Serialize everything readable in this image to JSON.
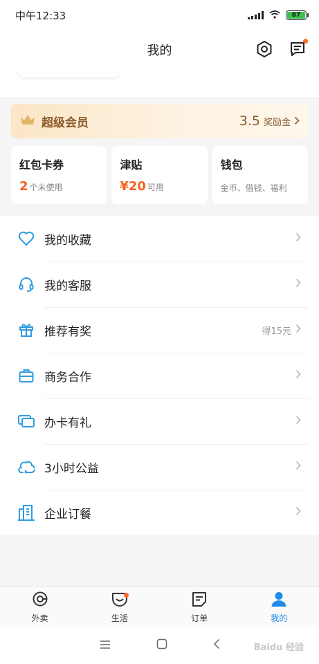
{
  "status_bar": {
    "time": "中午12:33",
    "battery": "87"
  },
  "header": {
    "title": "我的"
  },
  "vip": {
    "label": "超级会员",
    "amount": "3.5",
    "unit": "奖励金"
  },
  "cards": [
    {
      "title": "红包卡券",
      "number": "2",
      "suffix": "个未使用"
    },
    {
      "title": "津贴",
      "number": "¥20",
      "suffix": "可用"
    },
    {
      "title": "钱包",
      "number": "",
      "suffix": "金币、借钱、福利"
    }
  ],
  "menu": [
    {
      "label": "我的收藏",
      "icon": "heart-icon",
      "extra": ""
    },
    {
      "label": "我的客服",
      "icon": "headset-icon",
      "extra": ""
    },
    {
      "label": "推荐有奖",
      "icon": "gift-icon",
      "extra": "得15元"
    },
    {
      "label": "商务合作",
      "icon": "briefcase-icon",
      "extra": ""
    },
    {
      "label": "办卡有礼",
      "icon": "cards-icon",
      "extra": ""
    },
    {
      "label": "3小时公益",
      "icon": "charity-cloud-icon",
      "extra": ""
    },
    {
      "label": "企业订餐",
      "icon": "building-icon",
      "extra": ""
    }
  ],
  "tabs": [
    {
      "label": "外卖",
      "icon": "takeout-icon"
    },
    {
      "label": "生活",
      "icon": "life-icon"
    },
    {
      "label": "订单",
      "icon": "orders-icon"
    },
    {
      "label": "我的",
      "icon": "profile-icon"
    }
  ],
  "watermark": "Baidu 经验",
  "colors": {
    "accent": "#1e8ce8",
    "icon_blue": "#2f9be0",
    "highlight": "#f4611f",
    "gold": "#8a5a2b"
  }
}
